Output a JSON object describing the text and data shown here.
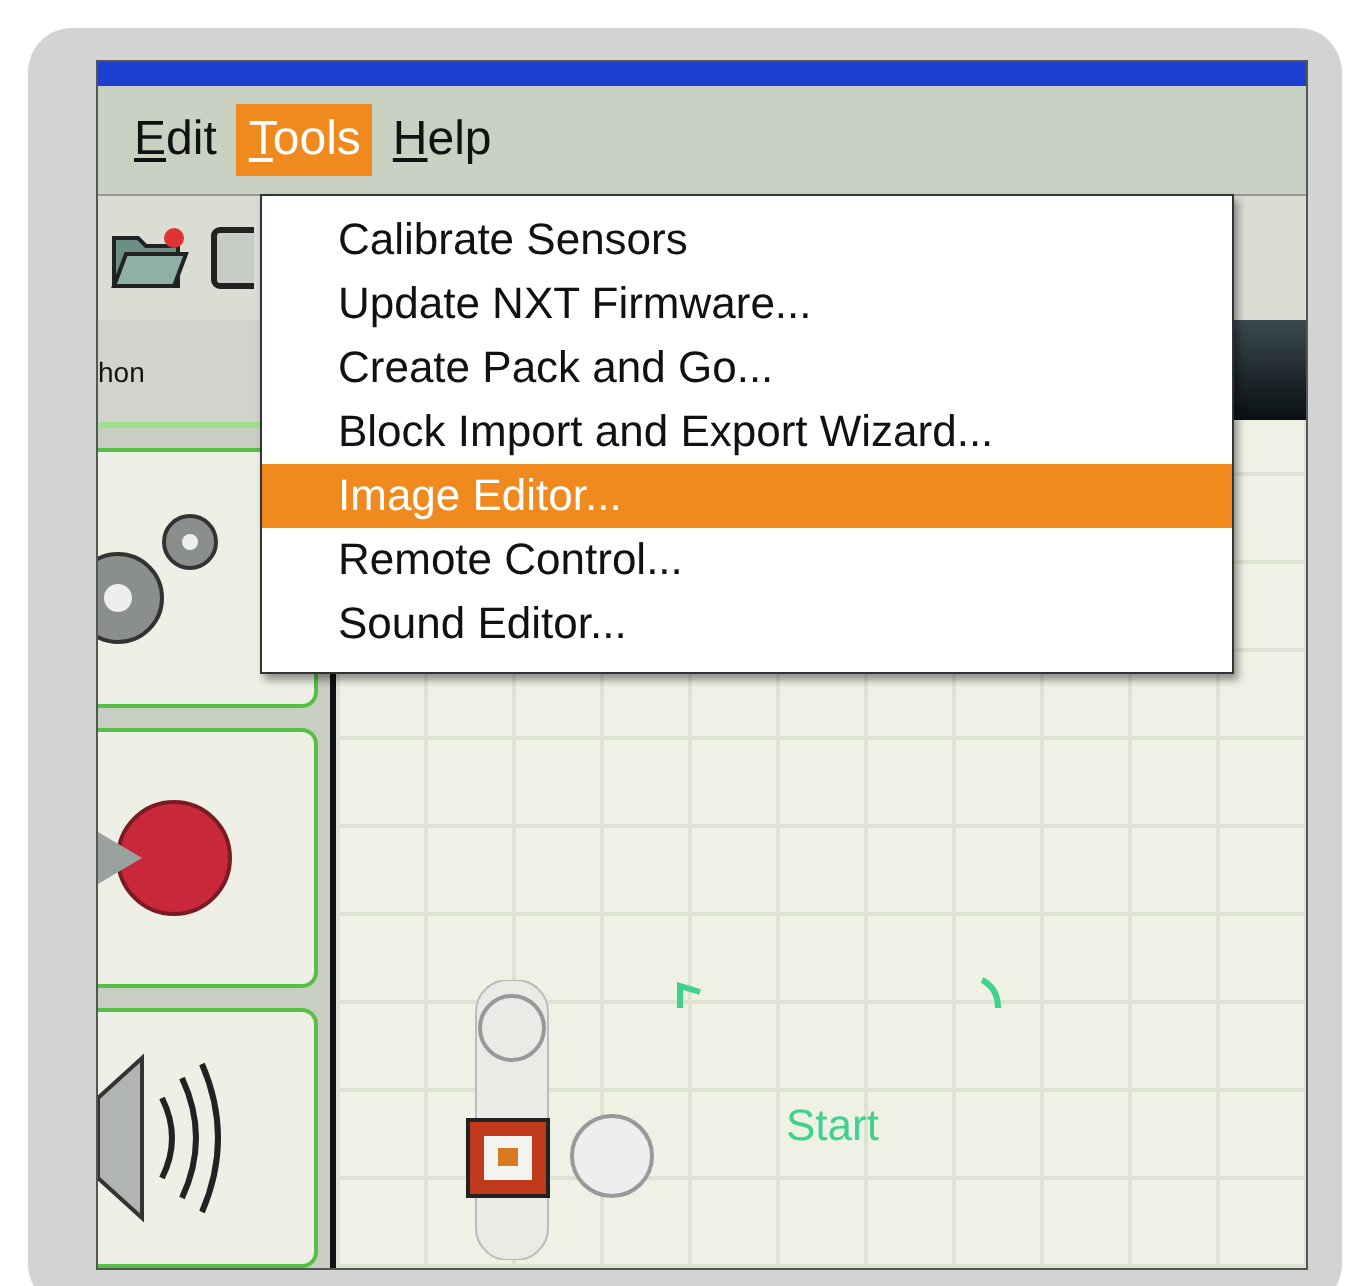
{
  "menu_bar": [
    {
      "label": "Edit",
      "selected": false
    },
    {
      "label": "Tools",
      "selected": true
    },
    {
      "label": "Help",
      "selected": false
    }
  ],
  "tools_menu": {
    "items": [
      {
        "label": "Calibrate Sensors",
        "selected": false
      },
      {
        "label": "Update NXT Firmware...",
        "selected": false
      },
      {
        "label": "Create Pack and Go...",
        "selected": false
      },
      {
        "label": "Block Import and Export Wizard...",
        "selected": false
      },
      {
        "label": "Image Editor...",
        "selected": true
      },
      {
        "label": "Remote Control...",
        "selected": false
      },
      {
        "label": "Sound Editor...",
        "selected": false
      }
    ]
  },
  "palette": {
    "header": "hon",
    "tiles": [
      {
        "kind": "gear"
      },
      {
        "kind": "record"
      },
      {
        "kind": "sound"
      }
    ]
  },
  "canvas": {
    "start_label": "Start"
  }
}
